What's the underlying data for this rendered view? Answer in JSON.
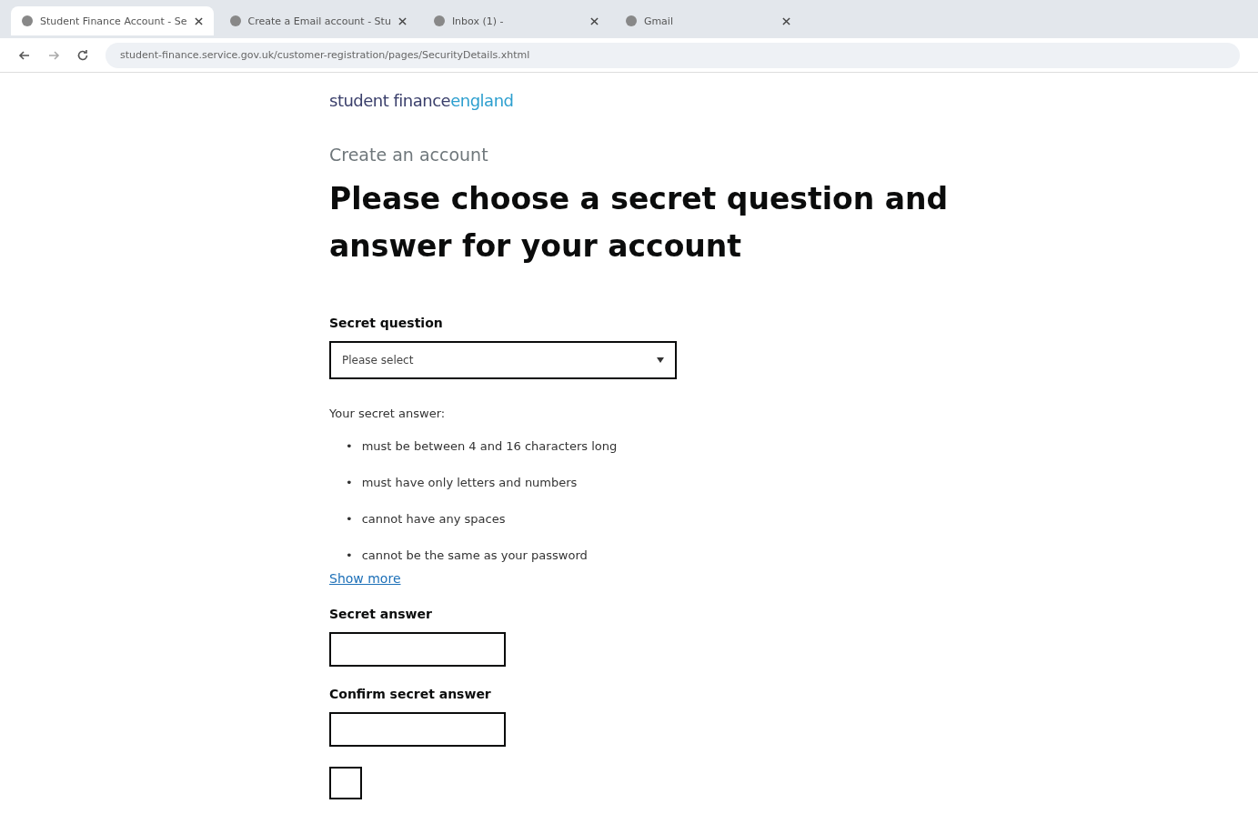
{
  "browser": {
    "tabs": [
      {
        "title": "Student Finance Account - Se",
        "selected": true
      },
      {
        "title": "Create a Email account - Stu",
        "selected": false
      },
      {
        "title": "Inbox (1) - ",
        "selected": false
      },
      {
        "title": "Gmail",
        "selected": false
      }
    ],
    "url": "student-finance.service.gov.uk/customer-registration/pages/SecurityDetails.xhtml"
  },
  "logo": {
    "main": "student finance",
    "accent": "england"
  },
  "caption": "Create an account",
  "heading": "Please choose a secret question and answer for your account",
  "secret_question": {
    "label": "Secret question",
    "placeholder": "Please select"
  },
  "rules_intro": "Your secret answer:",
  "rules": [
    {
      "bullet": "•",
      "text": "must be between 4 and 16 characters long"
    },
    {
      "bullet": "•",
      "text": "must have only letters and numbers"
    },
    {
      "bullet": "•",
      "text": "cannot have any spaces"
    },
    {
      "bullet": "•",
      "text": "cannot be the same as your password"
    }
  ],
  "show_more": "Show more",
  "fields": [
    {
      "label": "Secret answer"
    },
    {
      "label": "Confirm secret answer"
    }
  ],
  "checkbox": {
    "checked": false
  }
}
